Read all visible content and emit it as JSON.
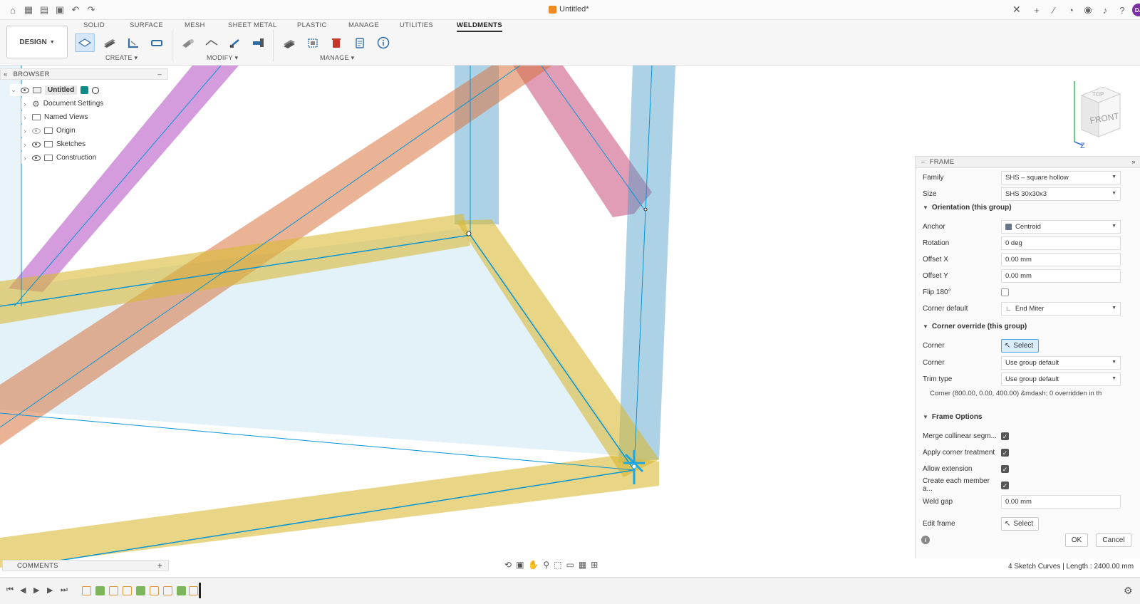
{
  "document": {
    "title": "Untitled*"
  },
  "ribbon": {
    "workspace": "DESIGN",
    "tabs": [
      "SOLID",
      "SURFACE",
      "MESH",
      "SHEET METAL",
      "PLASTIC",
      "MANAGE",
      "UTILITIES",
      "WELDMENTS"
    ],
    "active_tab": "WELDMENTS",
    "groups": {
      "create": "CREATE",
      "modify": "MODIFY",
      "manage": "MANAGE"
    }
  },
  "user": {
    "initials": "DJ"
  },
  "browser": {
    "title": "BROWSER",
    "root": "Untitled",
    "items": [
      "Document Settings",
      "Named Views",
      "Origin",
      "Sketches",
      "Construction"
    ]
  },
  "comments": {
    "title": "COMMENTS"
  },
  "viewcube": {
    "top": "TOP",
    "front": "FRONT",
    "axis_z": "Z"
  },
  "frame_panel": {
    "title": "FRAME",
    "family_label": "Family",
    "family_value": "SHS – square hollow",
    "size_label": "Size",
    "size_value": "SHS 30x30x3",
    "orientation_title": "Orientation (this group)",
    "anchor_label": "Anchor",
    "anchor_value": "Centroid",
    "rotation_label": "Rotation",
    "rotation_value": "0 deg",
    "offset_x_label": "Offset X",
    "offset_x_value": "0.00 mm",
    "offset_y_label": "Offset Y",
    "offset_y_value": "0.00 mm",
    "flip_label": "Flip 180°",
    "flip_checked": false,
    "corner_default_label": "Corner default",
    "corner_default_value": "End Miter",
    "override_title": "Corner override (this group)",
    "corner_select_label": "Corner",
    "select_text": "Select",
    "corner_label": "Corner",
    "corner_value": "Use group default",
    "trim_label": "Trim type",
    "trim_value": "Use group default",
    "corner_info": "Corner (800.00, 0.00, 400.00) &mdash; 0 overridden in th",
    "options_title": "Frame Options",
    "merge_label": "Merge collinear segm...",
    "apply_label": "Apply corner treatment",
    "allow_label": "Allow extension",
    "create_label": "Create each member a...",
    "weld_label": "Weld gap",
    "weld_value": "0.00 mm",
    "edit_label": "Edit frame",
    "ok": "OK",
    "cancel": "Cancel"
  },
  "status": {
    "text": "4 Sketch Curves | Length : 2400.00 mm"
  },
  "colors": {
    "accent": "#0696d7",
    "yellow": "#d8b934",
    "orange": "#d9743f",
    "purple": "#b04ac0",
    "pink": "#c84a7a",
    "blue": "#4a9cc8"
  }
}
